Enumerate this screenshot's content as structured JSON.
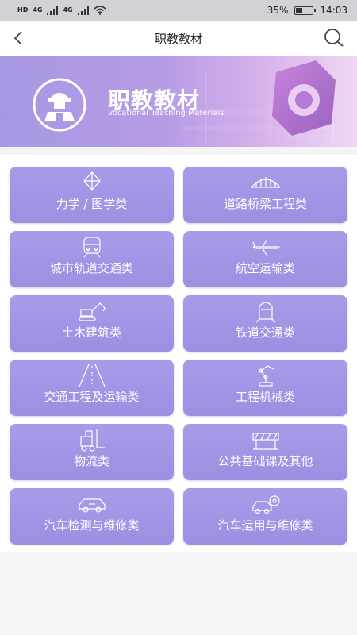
{
  "status_bar": {
    "net1": "HD",
    "net2": "4G",
    "net3": "4G",
    "battery_percent": "35%",
    "battery_level": 0.35,
    "time": "14:03"
  },
  "nav": {
    "title": "职教教材"
  },
  "banner": {
    "title": "职教教材",
    "subtitle": "Vocational Teaching Materials"
  },
  "categories": [
    {
      "label": "力学 / 图学类",
      "icon": "diamond-drawing-icon"
    },
    {
      "label": "道路桥梁工程类",
      "icon": "bridge-icon"
    },
    {
      "label": "城市轨道交通类",
      "icon": "metro-train-icon"
    },
    {
      "label": "航空运输类",
      "icon": "airplane-icon"
    },
    {
      "label": "土木建筑类",
      "icon": "excavator-icon"
    },
    {
      "label": "铁道交通类",
      "icon": "bullet-train-icon"
    },
    {
      "label": "交通工程及运输类",
      "icon": "road-icon"
    },
    {
      "label": "工程机械类",
      "icon": "robot-arm-icon"
    },
    {
      "label": "物流类",
      "icon": "forklift-icon"
    },
    {
      "label": "公共基础课及其他",
      "icon": "barrier-icon"
    },
    {
      "label": "汽车检测与维修类",
      "icon": "car-icon"
    },
    {
      "label": "汽车运用与维修类",
      "icon": "car-gear-icon"
    }
  ],
  "colors": {
    "tile": "#9b8fe1",
    "banner_start": "#a898e4",
    "banner_end": "#efd8f3"
  }
}
